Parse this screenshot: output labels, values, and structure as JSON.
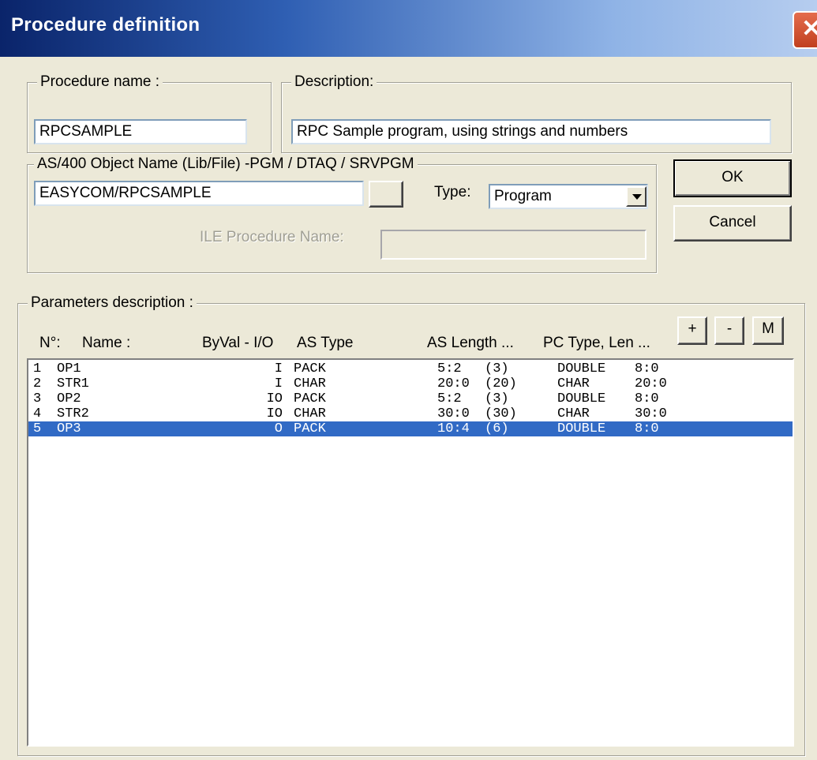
{
  "window": {
    "title": "Procedure definition"
  },
  "procedure_name": {
    "label": "Procedure name :",
    "value": "RPCSAMPLE"
  },
  "description": {
    "label": "Description:",
    "value": "RPC Sample program, using strings and numbers"
  },
  "object": {
    "label": "AS/400 Object Name (Lib/File) -PGM / DTAQ / SRVPGM",
    "value": "EASYCOM/RPCSAMPLE",
    "browse_label": "...",
    "type_label": "Type:",
    "type_value": "Program",
    "ile_label": "ILE Procedure Name:",
    "ile_value": ""
  },
  "buttons": {
    "ok": "OK",
    "cancel": "Cancel",
    "plus": "+",
    "minus": "-",
    "m": "M"
  },
  "parameters": {
    "label": "Parameters description :",
    "headers": {
      "num": "N°:",
      "name": "Name :",
      "byval": "ByVal - I/O",
      "astype": "AS Type",
      "aslength": "AS Length ...",
      "pctype": "PC Type, Len ..."
    },
    "rows": [
      {
        "num": "1",
        "name": "OP1",
        "io": "I",
        "astype": "PACK",
        "len": "5:2",
        "paren": "(3)",
        "pctype": "DOUBLE",
        "pclen": "8:0"
      },
      {
        "num": "2",
        "name": "STR1",
        "io": "I",
        "astype": "CHAR",
        "len": "20:0",
        "paren": "(20)",
        "pctype": "CHAR",
        "pclen": "20:0"
      },
      {
        "num": "3",
        "name": "OP2",
        "io": "IO",
        "astype": "PACK",
        "len": "5:2",
        "paren": "(3)",
        "pctype": "DOUBLE",
        "pclen": "8:0"
      },
      {
        "num": "4",
        "name": "STR2",
        "io": "IO",
        "astype": "CHAR",
        "len": "30:0",
        "paren": "(30)",
        "pctype": "CHAR",
        "pclen": "30:0"
      },
      {
        "num": "5",
        "name": "OP3",
        "io": "O",
        "astype": "PACK",
        "len": "10:4",
        "paren": "(6)",
        "pctype": "DOUBLE",
        "pclen": "8:0"
      }
    ],
    "selected_index": 4
  },
  "colors": {
    "titlebar_start": "#0a246a",
    "selection": "#316ac5",
    "face": "#ece9d8"
  }
}
